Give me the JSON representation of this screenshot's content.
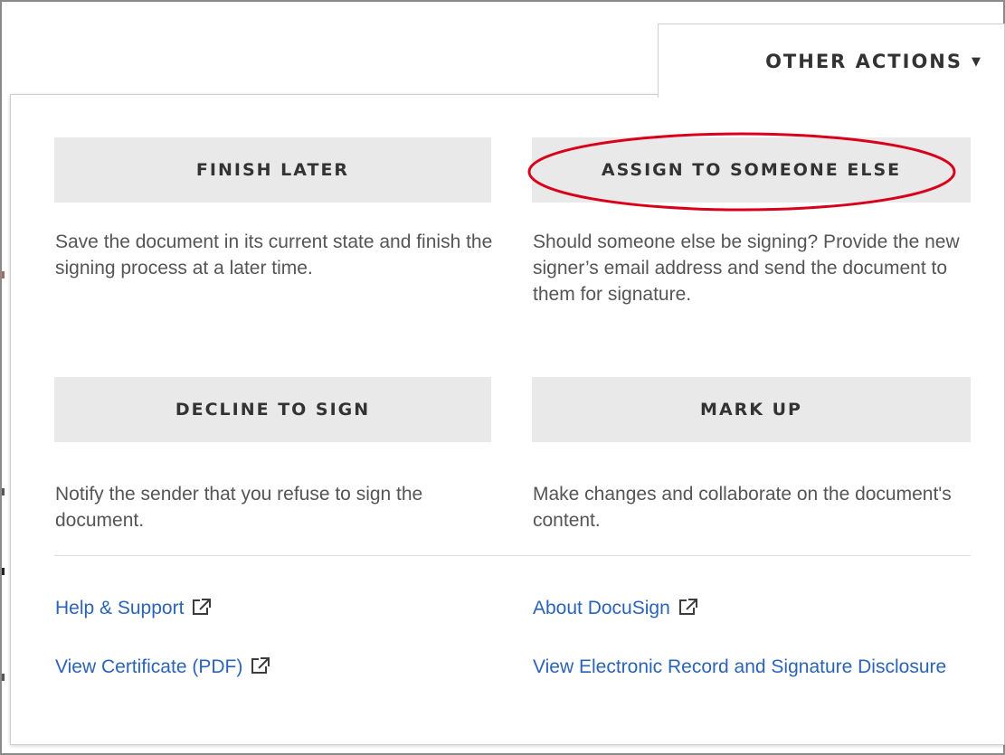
{
  "tab": {
    "label": "OTHER ACTIONS",
    "caret_icon": "caret-down-icon"
  },
  "actions": [
    {
      "label": "FINISH LATER",
      "description": "Save the document in its current state and finish the signing process at a later time."
    },
    {
      "label": "ASSIGN TO SOMEONE ELSE",
      "description": "Should someone else be signing? Provide the new signer’s email address and send the document to them for signature."
    },
    {
      "label": "DECLINE TO SIGN",
      "description": "Notify the sender that you refuse to sign the document."
    },
    {
      "label": "MARK UP",
      "description": "Make changes and collaborate on the document's content."
    }
  ],
  "links": [
    {
      "label": "Help & Support",
      "icon": "external-link-icon"
    },
    {
      "label": "About DocuSign",
      "icon": "external-link-icon"
    },
    {
      "label": "View Certificate (PDF)",
      "icon": "external-link-icon"
    },
    {
      "label": "View Electronic Record and Signature Disclosure"
    }
  ],
  "colors": {
    "button_bg": "#e9e9e9",
    "link": "#2b64b6",
    "highlight_annotation": "#d9001b"
  }
}
